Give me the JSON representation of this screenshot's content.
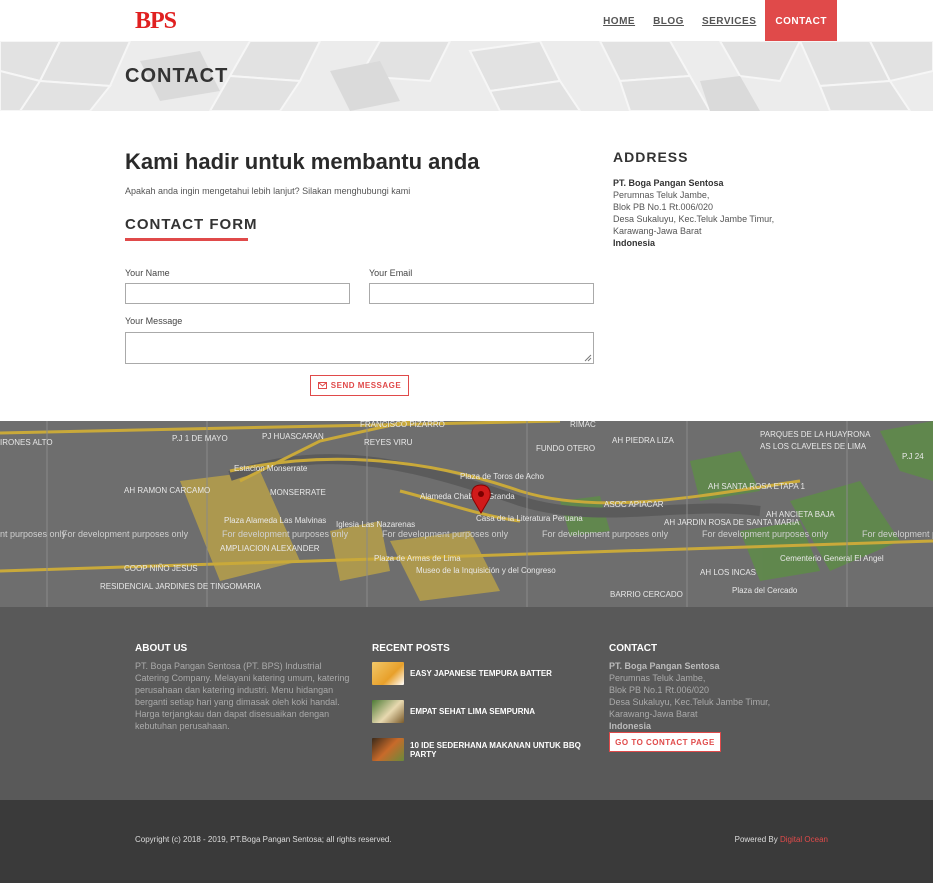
{
  "header": {
    "logo_text": "BPS",
    "nav": [
      {
        "label": "HOME",
        "active": false
      },
      {
        "label": "BLOG",
        "active": false
      },
      {
        "label": "SERVICES",
        "active": false
      },
      {
        "label": "CONTACT",
        "active": true
      }
    ]
  },
  "banner": {
    "title": "CONTACT"
  },
  "main": {
    "heading": "Kami hadir untuk membantu anda",
    "intro": "Apakah anda ingin mengetahui lebih lanjut? Silakan menghubungi kami",
    "form_title": "CONTACT FORM",
    "name_label": "Your Name",
    "email_label": "Your Email",
    "message_label": "Your Message",
    "send_label": "SEND MESSAGE"
  },
  "address": {
    "title": "ADDRESS",
    "company": "PT. Boga Pangan Sentosa",
    "line1": "Perumnas Teluk Jambe,",
    "line2": "Blok PB No.1 Rt.006/020",
    "line3": "Desa Sukaluyu, Kec.Teluk Jambe Timur,",
    "line4": "Karawang-Jawa Barat",
    "country": "Indonesia"
  },
  "map": {
    "watermark": "For development purposes only",
    "labels": [
      "FRANCISCO PIZARRO",
      "RIMAC",
      "PARQUES DE LA HUAYRONA",
      "P.J 1 DE MAYO",
      "PJ HUASCARAN",
      "REYES VIRU",
      "FUNDO OTERO",
      "AH PIEDRA LIZA",
      "AS LOS CLAVELES DE LIMA",
      "P.J 24",
      "IRONES ALTO",
      "Estacion Monserrate",
      "Plaza de Toros de Acho",
      "AH SANTA ROSA ETAPA 1",
      "AH RAMON CARCAMO",
      "MONSERRATE",
      "Alameda Chabuca Granda",
      "ASOC APIACAR",
      "AH ANCIETA BAJA",
      "Plaza Alameda Las Malvinas",
      "Iglesia Las Nazarenas",
      "Casa de la Literatura Peruana",
      "AH JARDIN ROSA DE SANTA MARIA",
      "AMPLIACION ALEXANDER",
      "Plaza de Armas de Lima",
      "Cementerio General El Angel",
      "COOP NIÑO JESUS",
      "AH LOS INCAS",
      "RESIDENCIAL JARDINES DE TINGOMARIA",
      "Museo de la Inquisición y del Congreso",
      "BARRIO CERCADO",
      "Plaza del Cercado"
    ]
  },
  "footer": {
    "about_title": "ABOUT US",
    "about_text": "PT. Boga Pangan Sentosa (PT. BPS) Industrial Catering Company. Melayani katering umum, katering perusahaan dan katering industri. Menu hidangan berganti setiap hari yang dimasak oleh koki handal. Harga terjangkau dan dapat disesuaikan dengan kebutuhan perusahaan.",
    "posts_title": "RECENT POSTS",
    "posts": [
      "EASY JAPANESE TEMPURA BATTER",
      "EMPAT SEHAT LIMA SEMPURNA",
      "10 IDE SEDERHANA MAKANAN UNTUK BBQ PARTY"
    ],
    "contact_title": "CONTACT",
    "company": "PT. Boga Pangan Sentosa",
    "line1": "Perumnas Teluk Jambe,",
    "line2": "Blok PB No.1 Rt.006/020",
    "line3": "Desa Sukaluyu, Kec.Teluk Jambe Timur,",
    "line4": "Karawang-Jawa Barat",
    "country": "Indonesia",
    "goto_label": "GO TO CONTACT PAGE"
  },
  "bottom": {
    "copyright": "Copyright (c) 2018 - 2019, PT.Boga Pangan Sentosa; all rights reserved.",
    "powered_prefix": "Powered By ",
    "powered_link": "Digital Ocean"
  },
  "colors": {
    "accent": "#e04a4a",
    "footer": "#595959",
    "bottom": "#3a3a3a"
  }
}
